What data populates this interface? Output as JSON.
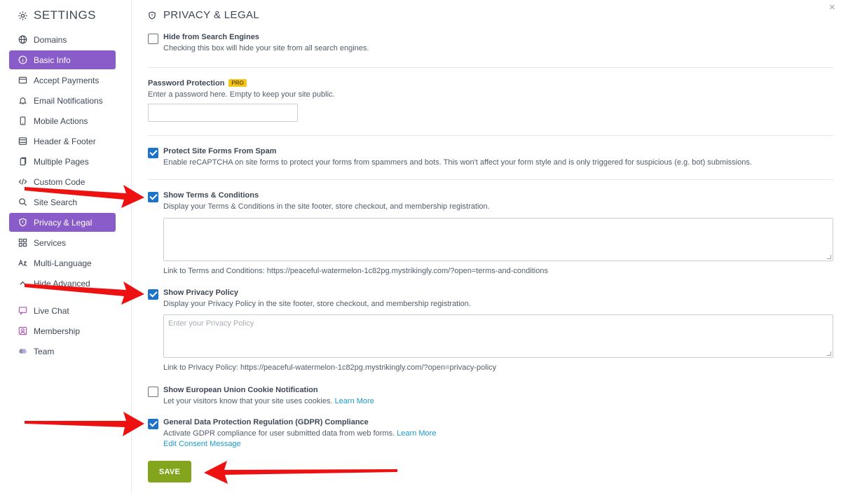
{
  "sidebar": {
    "title": "SETTINGS",
    "items": [
      {
        "label": "Domains",
        "icon": "globe-icon"
      },
      {
        "label": "Basic Info",
        "icon": "info-icon"
      },
      {
        "label": "Accept Payments",
        "icon": "card-icon"
      },
      {
        "label": "Email Notifications",
        "icon": "bell-icon"
      },
      {
        "label": "Mobile Actions",
        "icon": "mobile-icon"
      },
      {
        "label": "Header & Footer",
        "icon": "layout-icon"
      },
      {
        "label": "Multiple Pages",
        "icon": "pages-icon"
      },
      {
        "label": "Custom Code",
        "icon": "code-icon"
      },
      {
        "label": "Site Search",
        "icon": "search-icon"
      },
      {
        "label": "Privacy & Legal",
        "icon": "shield-icon"
      },
      {
        "label": "Services",
        "icon": "grid-icon"
      },
      {
        "label": "Multi-Language",
        "icon": "translate-icon"
      },
      {
        "label": "Hide Advanced",
        "icon": "chevron-up-icon"
      },
      {
        "label": "Live Chat",
        "icon": "chat-icon"
      },
      {
        "label": "Membership",
        "icon": "member-icon"
      },
      {
        "label": "Team",
        "icon": "team-icon"
      }
    ],
    "accent": "#8a5cc9"
  },
  "page": {
    "title": "PRIVACY & LEGAL",
    "close": "×"
  },
  "options": {
    "hide_search": {
      "title": "Hide from Search Engines",
      "desc": "Checking this box will hide your site from all search engines.",
      "checked": false
    },
    "password": {
      "title": "Password Protection",
      "badge": "PRO",
      "desc": "Enter a password here. Empty to keep your site public.",
      "value": ""
    },
    "spam": {
      "title": "Protect Site Forms From Spam",
      "desc": "Enable reCAPTCHA on site forms to protect your forms from spammers and bots. This won't affect your form style and is only triggered for suspicious (e.g. bot) submissions.",
      "checked": true
    },
    "terms": {
      "title": "Show Terms & Conditions",
      "desc": "Display your Terms & Conditions in the site footer, store checkout, and membership registration.",
      "value": "",
      "link": "Link to Terms and Conditions: https://peaceful-watermelon-1c82pg.mystrikingly.com/?open=terms-and-conditions",
      "checked": true
    },
    "privacy": {
      "title": "Show Privacy Policy",
      "desc": "Display your Privacy Policy in the site footer, store checkout, and membership registration.",
      "placeholder": "Enter your Privacy Policy",
      "link": "Link to Privacy Policy: https://peaceful-watermelon-1c82pg.mystrikingly.com/?open=privacy-policy",
      "checked": true
    },
    "cookie": {
      "title": "Show European Union Cookie Notification",
      "desc": "Let your visitors know that your site uses cookies.",
      "learn_more": "Learn More",
      "checked": false
    },
    "gdpr": {
      "title": "General Data Protection Regulation (GDPR) Compliance",
      "desc": "Activate GDPR compliance for user submitted data from web forms.",
      "learn_more": "Learn More",
      "edit_link": "Edit Consent Message",
      "checked": true
    }
  },
  "save_label": "SAVE",
  "colors": {
    "checkbox": "#1d73c9",
    "save": "#82a51d",
    "link": "#1a9ac9",
    "arrow": "#ee1111"
  }
}
